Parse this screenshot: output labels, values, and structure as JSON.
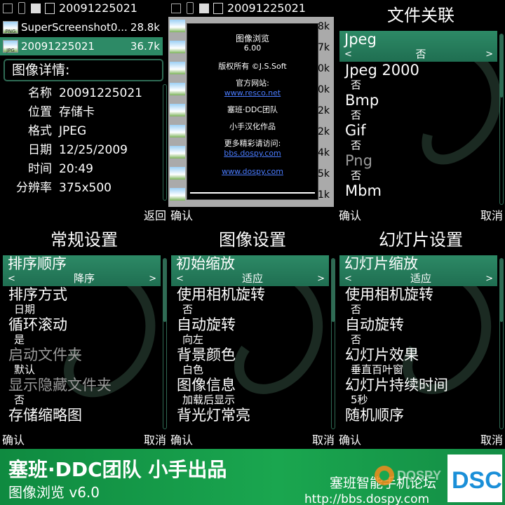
{
  "file_browser": {
    "status_filename": "20091225021",
    "files": [
      {
        "name": "SuperScreenshot0...",
        "size": "28.8k",
        "selected": false
      },
      {
        "name": "20091225021",
        "size": "36.7k",
        "selected": true
      }
    ],
    "details_title": "图像详情:",
    "details": [
      {
        "label": "名称",
        "value": "20091225021"
      },
      {
        "label": "位置",
        "value": "存储卡"
      },
      {
        "label": "格式",
        "value": "JPEG"
      },
      {
        "label": "日期",
        "value": "12/25/2009"
      },
      {
        "label": "时间",
        "value": "20:49"
      },
      {
        "label": "分辨率",
        "value": "375x500"
      }
    ],
    "softkey_right": "返回"
  },
  "about_panel": {
    "status_filename": "20091225021",
    "bg_sizes": [
      "8k",
      "7k",
      "0k",
      "0k",
      "2k",
      "2k",
      "4k",
      "5k",
      "1k"
    ],
    "lines": {
      "title": "图像浏览",
      "version": "6.00",
      "copyright": "版权所有 ©J.S.Soft",
      "site_label": "官方网站:",
      "site_url": "www.resco.net",
      "team": "塞班·DDC团队",
      "translator": "小手汉化作品",
      "more_label": "更多精彩请访问:",
      "forum_url": "bbs.dospy.com",
      "dospy_url": "www.dospy.com"
    },
    "softkey_left": "确认"
  },
  "file_assoc": {
    "title": "文件关联",
    "items": [
      {
        "label": "Jpeg",
        "value": "否",
        "selected": true
      },
      {
        "label": "Jpeg 2000",
        "value": "否"
      },
      {
        "label": "Bmp",
        "value": "否"
      },
      {
        "label": "Gif",
        "value": "否"
      },
      {
        "label": "Png",
        "value": "否",
        "dim": true
      },
      {
        "label": "Mbm",
        "value": ""
      }
    ],
    "softkey_left": "确认",
    "softkey_right": "取消"
  },
  "general": {
    "title": "常规设置",
    "items": [
      {
        "label": "排序顺序",
        "value": "降序",
        "selected": true
      },
      {
        "label": "排序方式",
        "value": "日期"
      },
      {
        "label": "循环滚动",
        "value": "是"
      },
      {
        "label": "启动文件夹",
        "value": "默认",
        "dim": true
      },
      {
        "label": "显示隐藏文件夹",
        "value": "否",
        "dim": true
      },
      {
        "label": "存储缩略图",
        "value": ""
      }
    ],
    "softkey_left": "确认",
    "softkey_right": "取消"
  },
  "image": {
    "title": "图像设置",
    "items": [
      {
        "label": "初始缩放",
        "value": "适应",
        "selected": true
      },
      {
        "label": "使用相机旋转",
        "value": "否"
      },
      {
        "label": "自动旋转",
        "value": "向左"
      },
      {
        "label": "背景颜色",
        "value": "白色"
      },
      {
        "label": "图像信息",
        "value": "加载后显示"
      },
      {
        "label": "背光灯常亮",
        "value": ""
      }
    ],
    "softkey_left": "确认",
    "softkey_right": "取消"
  },
  "slideshow": {
    "title": "幻灯片设置",
    "items": [
      {
        "label": "幻灯片缩放",
        "value": "适应",
        "selected": true
      },
      {
        "label": "使用相机旋转",
        "value": "否"
      },
      {
        "label": "自动旋转",
        "value": "否"
      },
      {
        "label": "幻灯片效果",
        "value": "垂直百叶窗"
      },
      {
        "label": "幻灯片持续时间",
        "value": "5秒"
      },
      {
        "label": "随机顺序",
        "value": ""
      }
    ],
    "softkey_left": "确认",
    "softkey_right": "取消"
  },
  "banner": {
    "title": "塞班·DDC团队 小手出品",
    "subtitle": "图像浏览 v6.0",
    "forum_name": "塞班智能手机论坛",
    "url": "http://bbs.dospy.com",
    "logo_text": "DOSPY",
    "logo2_text": "DSC"
  },
  "colors": {
    "accent": "#2d8a66",
    "banner_green": "#1aa64f",
    "link": "#4a7cff"
  }
}
